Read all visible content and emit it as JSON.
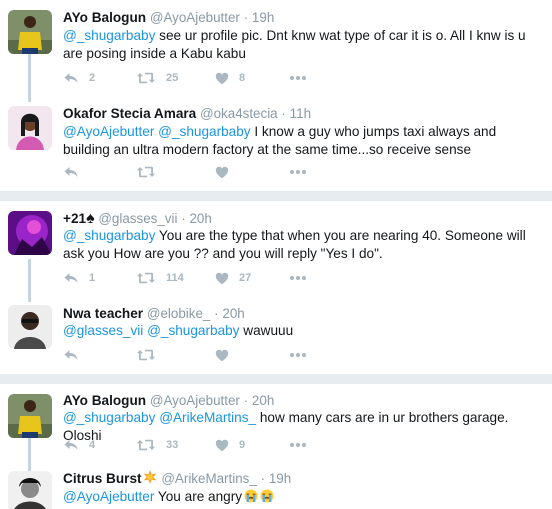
{
  "tweets": [
    {
      "name": "AYo Balogun",
      "handle": "@AyoAjebutter",
      "dot": "·",
      "time": "19h",
      "mention1": "@_shugarbaby",
      "text1": " see ur profile pic. Dnt knw wat type of car it is o. All I knw is u are posing inside a Kabu kabu",
      "reply_count": "2",
      "retweet_count": "25",
      "like_count": "8",
      "avatar_icon": "avatar-yellow-shirt",
      "avatar_color": "#e8c51a"
    },
    {
      "name": "Okafor Stecia Amara",
      "handle": "@oka4stecia",
      "dot": "·",
      "time": "11h",
      "mention1": "@AyoAjebutter",
      "mention2": "@_shugarbaby",
      "text1": " I know a guy who jumps taxi always and building an ultra modern factory at the same time...so receive sense",
      "avatar_icon": "avatar-woman",
      "avatar_color": "#d45bb3"
    },
    {
      "name": "+21",
      "name_suffix": "♠",
      "handle": "@glasses_vii",
      "dot": "·",
      "time": "20h",
      "mention1": "@_shugarbaby",
      "text1": " You are the type that when you are nearing 40. Someone will ask you How are you ?? and you will reply \"Yes I do\".",
      "reply_count": "1",
      "retweet_count": "114",
      "like_count": "27",
      "avatar_icon": "avatar-purple-light",
      "avatar_color": "#9b24c8"
    },
    {
      "name": "Nwa teacher",
      "handle": "@elobike_",
      "dot": "·",
      "time": "20h",
      "mention1": "@glasses_vii",
      "mention2": "@_shugarbaby",
      "text1": " wawuuu",
      "avatar_icon": "avatar-man-gray",
      "avatar_color": "#dcdcdc"
    },
    {
      "name": "AYo Balogun",
      "handle": "@AyoAjebutter",
      "dot": "·",
      "time": "20h",
      "mention1": "@_shugarbaby",
      "mention2": "@ArikeMartins_",
      "text1": " how many cars are in ur brothers garage. Oloshi",
      "reply_count": "4",
      "retweet_count": "33",
      "like_count": "9",
      "avatar_icon": "avatar-yellow-shirt",
      "avatar_color": "#e8c51a"
    },
    {
      "name": "Citrus Burst",
      "handle": "@ArikeMartins_",
      "dot": "·",
      "time": "19h",
      "mention1": "@AyoAjebutter",
      "text1": " You are angry",
      "emoji": "crying-face-icon",
      "avatar_icon": "avatar-woman-bw",
      "avatar_color": "#333333"
    }
  ],
  "icons": {
    "reply": "reply-icon",
    "retweet": "retweet-icon",
    "like": "heart-icon",
    "more": "more-icon",
    "badge": "sun-badge-icon"
  },
  "colors": {
    "background": "#e6ecf0",
    "mention": "#1b95e0",
    "action_gray": "#aab8c2",
    "meta_gray": "#8899a6",
    "thread_line": "#c4d5e1"
  }
}
